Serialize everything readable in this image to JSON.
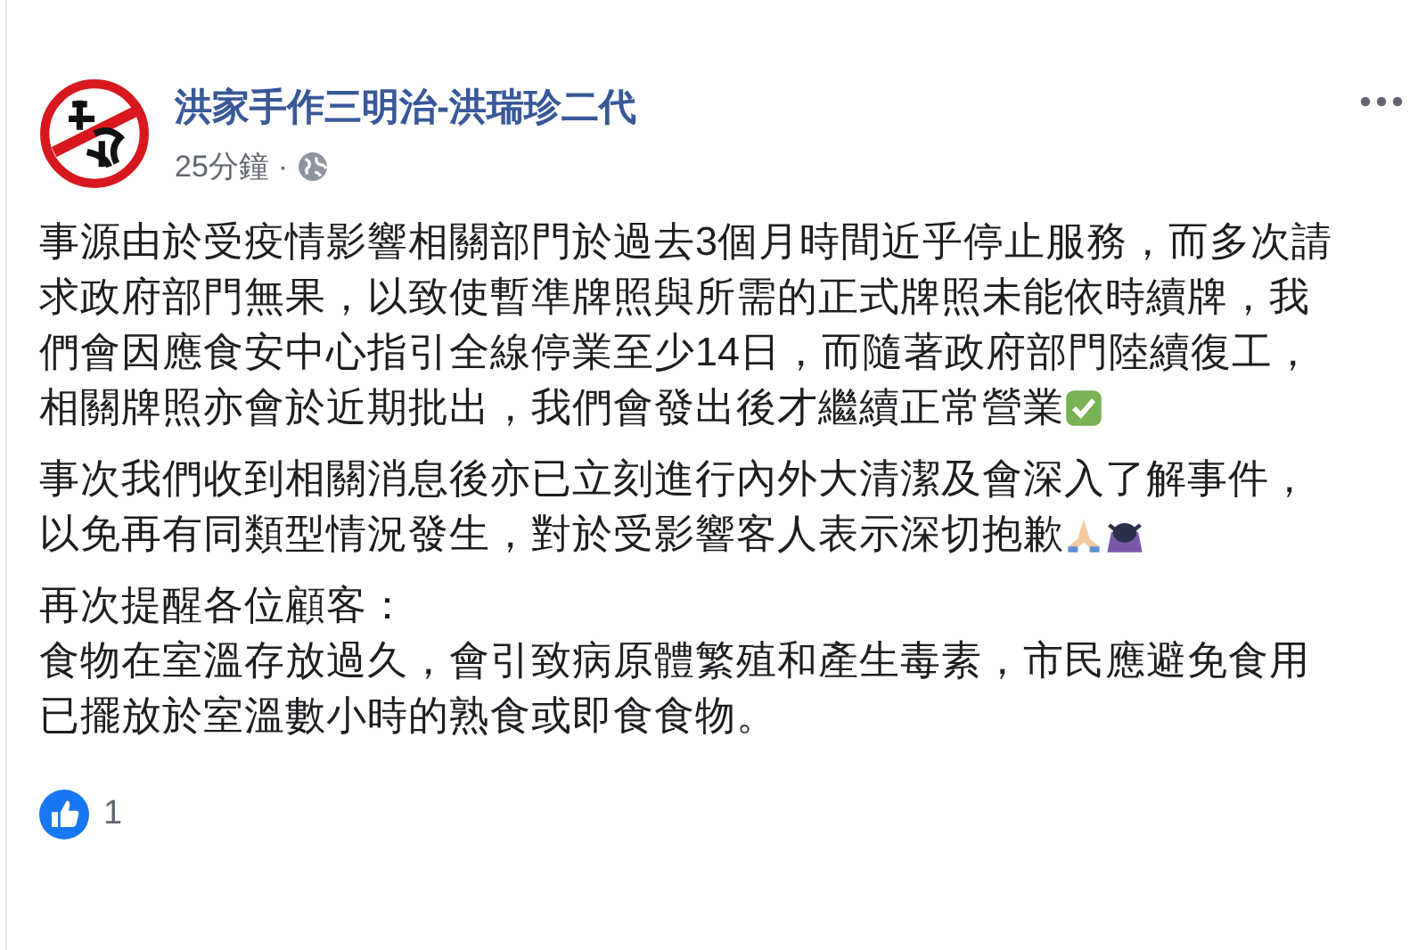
{
  "post": {
    "author": "洪家手作三明治-洪瑞珍二代",
    "time": "25分鐘",
    "separator": "·",
    "paragraphs": [
      {
        "lines": [
          "事源由於受疫情影響相關部門於過去3個月時間近乎停止服務，而多次請",
          "求政府部門無果，以致使暫準牌照與所需的正式牌照未能依時續牌，我",
          "們會因應食安中心指引全線停業至少14日，而隨著政府部門陸續復工，",
          "相關牌照亦會於近期批出，我們會發出後才繼續正常營業"
        ],
        "emoji": [
          {
            "kind": "check"
          }
        ]
      },
      {
        "lines": [
          "事次我們收到相關消息後亦已立刻進行內外大清潔及會深入了解事件，",
          "以免再有同類型情況發生，對於受影響客人表示深切抱歉"
        ],
        "emoji": [
          {
            "kind": "pray"
          },
          {
            "kind": "bow"
          }
        ]
      },
      {
        "lines": [
          "再次提醒各位顧客：",
          "食物在室溫存放過久，會引致病原體繁殖和產生毒素，市民應避免食用",
          "已擺放於室溫數小時的熟食或即食食物。"
        ]
      }
    ],
    "reactions": {
      "count": "1"
    }
  }
}
